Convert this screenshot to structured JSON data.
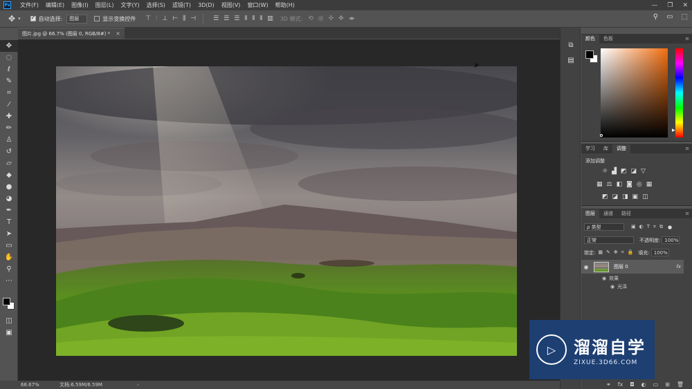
{
  "app": {
    "logo": "Ps"
  },
  "menu": [
    "文件(F)",
    "编辑(E)",
    "图像(I)",
    "图层(L)",
    "文字(Y)",
    "选择(S)",
    "滤镜(T)",
    "3D(D)",
    "视图(V)",
    "窗口(W)",
    "帮助(H)"
  ],
  "window_controls": {
    "minimize": "—",
    "restore": "❐",
    "close": "✕"
  },
  "options": {
    "tool_icon": "move-icon",
    "auto_select_label": "自动选择:",
    "auto_select_checked": true,
    "auto_select_value": "图层",
    "show_transform_label": "显示变换控件",
    "show_transform_checked": false,
    "mode_3d_label": "3D 模式:"
  },
  "document": {
    "tab_title": "图片.jpg @ 66.7% (图层 0, RGB/8#) *",
    "close": "×"
  },
  "status": {
    "zoom": "66.67%",
    "doc_size": "文档:6.59M/6.59M",
    "arrow": "›"
  },
  "color_panel": {
    "tabs": [
      "颜色",
      "色板"
    ],
    "active_tab": 0
  },
  "adjust_panel": {
    "tabs": [
      "学习",
      "库",
      "调整"
    ],
    "active_tab": 2,
    "title": "添加调整"
  },
  "layers_panel": {
    "tabs": [
      "图层",
      "通道",
      "路径"
    ],
    "active_tab": 0,
    "filter_label": "ρ 类型",
    "blend_mode": "正常",
    "opacity_label": "不透明度:",
    "opacity_value": "100%",
    "lock_label": "锁定:",
    "fill_label": "填充:",
    "fill_value": "100%",
    "layers": [
      {
        "name": "图层 0",
        "fx": "fx",
        "effects_label": "效果",
        "effect_name": "光泽"
      }
    ]
  },
  "watermark": {
    "title": "溜溜自学",
    "subtitle": "ZIXUE.3D66.COM"
  },
  "colors": {
    "accent": "#31a8ff",
    "watermark_bg": "#1d3f72",
    "foreground": "#000000",
    "background": "#ffffff"
  }
}
